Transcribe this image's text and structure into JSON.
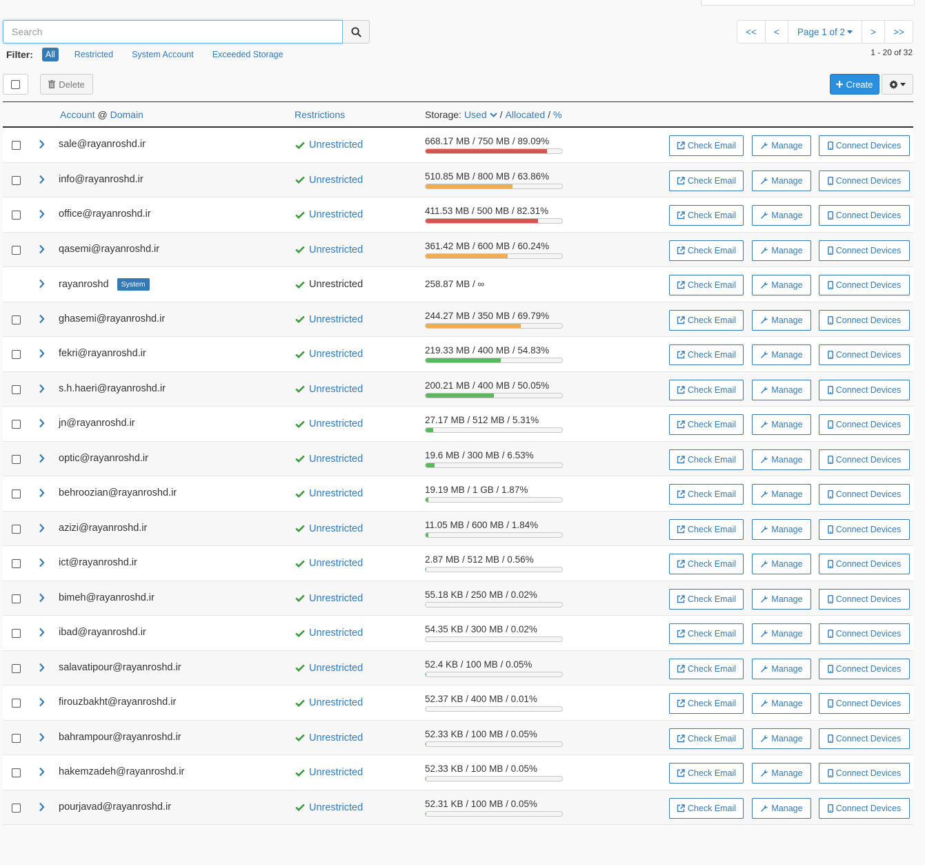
{
  "search": {
    "placeholder": "Search"
  },
  "filter": {
    "label": "Filter:",
    "options": [
      "All",
      "Restricted",
      "System Account",
      "Exceeded Storage"
    ]
  },
  "pager": {
    "first": "<<",
    "prev": "<",
    "page": "Page 1 of 2",
    "next": ">",
    "last": ">>",
    "range": "1 - 20 of 32"
  },
  "toolbar": {
    "delete": "Delete",
    "create": "Create"
  },
  "header": {
    "account": "Account",
    "at": "@",
    "domain": "Domain",
    "restrictions": "Restrictions",
    "storage": "Storage:",
    "used": "Used",
    "slash1": "/",
    "allocated": "Allocated",
    "slash2": "/",
    "pct": "%"
  },
  "actions": {
    "check": "Check Email",
    "manage": "Manage",
    "connect": "Connect Devices"
  },
  "colors": {
    "accent": "#337ab7",
    "red": "#d9534f",
    "orange": "#f0ad4e",
    "green": "#5cb85c"
  },
  "rows": [
    {
      "account": "sale@rayanroshd.ir",
      "restriction": "Unrestricted",
      "storage": "668.17 MB / 750 MB / 89.09%",
      "pct": 89.09,
      "level": "red"
    },
    {
      "account": "info@rayanroshd.ir",
      "restriction": "Unrestricted",
      "storage": "510.85 MB / 800 MB / 63.86%",
      "pct": 63.86,
      "level": "orange"
    },
    {
      "account": "office@rayanroshd.ir",
      "restriction": "Unrestricted",
      "storage": "411.53 MB / 500 MB / 82.31%",
      "pct": 82.31,
      "level": "red"
    },
    {
      "account": "qasemi@rayanroshd.ir",
      "restriction": "Unrestricted",
      "storage": "361.42 MB / 600 MB / 60.24%",
      "pct": 60.24,
      "level": "orange"
    },
    {
      "account": "rayanroshd",
      "badge": "System",
      "restriction": "Unrestricted",
      "storage": "258.87 MB / ∞",
      "system": true
    },
    {
      "account": "ghasemi@rayanroshd.ir",
      "restriction": "Unrestricted",
      "storage": "244.27 MB / 350 MB / 69.79%",
      "pct": 69.79,
      "level": "orange"
    },
    {
      "account": "fekri@rayanroshd.ir",
      "restriction": "Unrestricted",
      "storage": "219.33 MB / 400 MB / 54.83%",
      "pct": 54.83,
      "level": "green"
    },
    {
      "account": "s.h.haeri@rayanroshd.ir",
      "restriction": "Unrestricted",
      "storage": "200.21 MB / 400 MB / 50.05%",
      "pct": 50.05,
      "level": "green"
    },
    {
      "account": "jn@rayanroshd.ir",
      "restriction": "Unrestricted",
      "storage": "27.17 MB / 512 MB / 5.31%",
      "pct": 5.31,
      "level": "green"
    },
    {
      "account": "optic@rayanroshd.ir",
      "restriction": "Unrestricted",
      "storage": "19.6 MB / 300 MB / 6.53%",
      "pct": 6.53,
      "level": "green"
    },
    {
      "account": "behroozian@rayanroshd.ir",
      "restriction": "Unrestricted",
      "storage": "19.19 MB / 1 GB / 1.87%",
      "pct": 1.87,
      "level": "green"
    },
    {
      "account": "azizi@rayanroshd.ir",
      "restriction": "Unrestricted",
      "storage": "11.05 MB / 600 MB / 1.84%",
      "pct": 1.84,
      "level": "green"
    },
    {
      "account": "ict@rayanroshd.ir",
      "restriction": "Unrestricted",
      "storage": "2.87 MB / 512 MB / 0.56%",
      "pct": 0.56,
      "level": "green"
    },
    {
      "account": "bimeh@rayanroshd.ir",
      "restriction": "Unrestricted",
      "storage": "55.18 KB / 250 MB / 0.02%",
      "pct": 0.02,
      "level": "green"
    },
    {
      "account": "ibad@rayanroshd.ir",
      "restriction": "Unrestricted",
      "storage": "54.35 KB / 300 MB / 0.02%",
      "pct": 0.02,
      "level": "green"
    },
    {
      "account": "salavatipour@rayanroshd.ir",
      "restriction": "Unrestricted",
      "storage": "52.4 KB / 100 MB / 0.05%",
      "pct": 0.05,
      "level": "green"
    },
    {
      "account": "firouzbakht@rayanroshd.ir",
      "restriction": "Unrestricted",
      "storage": "52.37 KB / 400 MB / 0.01%",
      "pct": 0.01,
      "level": "green"
    },
    {
      "account": "bahrampour@rayanroshd.ir",
      "restriction": "Unrestricted",
      "storage": "52.33 KB / 100 MB / 0.05%",
      "pct": 0.05,
      "level": "green"
    },
    {
      "account": "hakemzadeh@rayanroshd.ir",
      "restriction": "Unrestricted",
      "storage": "52.33 KB / 100 MB / 0.05%",
      "pct": 0.05,
      "level": "green"
    },
    {
      "account": "pourjavad@rayanroshd.ir",
      "restriction": "Unrestricted",
      "storage": "52.31 KB / 100 MB / 0.05%",
      "pct": 0.05,
      "level": "green"
    }
  ]
}
